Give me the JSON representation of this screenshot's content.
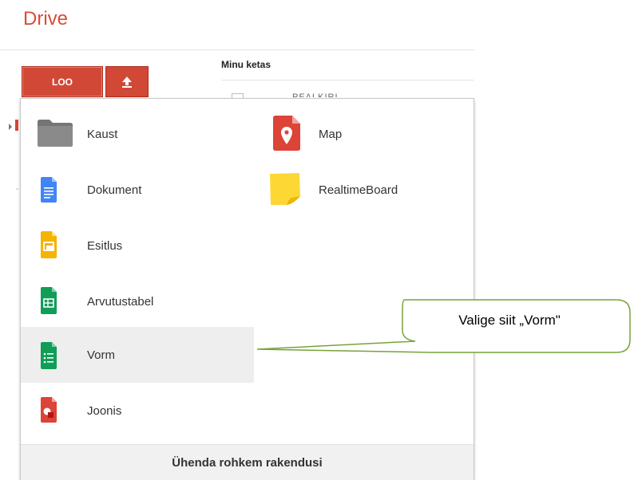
{
  "app": {
    "title": "Drive"
  },
  "toolbar": {
    "create_label": "LOO",
    "upload_icon": "upload-icon"
  },
  "breadcrumb": {
    "label": "Minu ketas"
  },
  "file_row": {
    "partial_text": "PEALKIRI"
  },
  "menu": {
    "items_left": [
      {
        "label": "Kaust",
        "icon": "folder-icon",
        "color": "#757575"
      },
      {
        "label": "Dokument",
        "icon": "docs-icon",
        "color": "#4285f4"
      },
      {
        "label": "Esitlus",
        "icon": "slides-icon",
        "color": "#f4b400"
      },
      {
        "label": "Arvutustabel",
        "icon": "sheets-icon",
        "color": "#0f9d58"
      },
      {
        "label": "Vorm",
        "icon": "forms-icon",
        "color": "#0f9d58"
      },
      {
        "label": "Joonis",
        "icon": "drawings-icon",
        "color": "#db4437"
      }
    ],
    "items_right": [
      {
        "label": "Map",
        "icon": "map-icon",
        "color": "#db4437"
      },
      {
        "label": "RealtimeBoard",
        "icon": "realtimeboard-icon",
        "color": "#fdd835"
      }
    ],
    "footer_label": "Ühenda rohkem rakendusi"
  },
  "callout": {
    "text": "Valige siit „Vorm\""
  },
  "colors": {
    "accent": "#d14836",
    "callout_border": "#77a33a",
    "highlight": "#eeeeee"
  }
}
